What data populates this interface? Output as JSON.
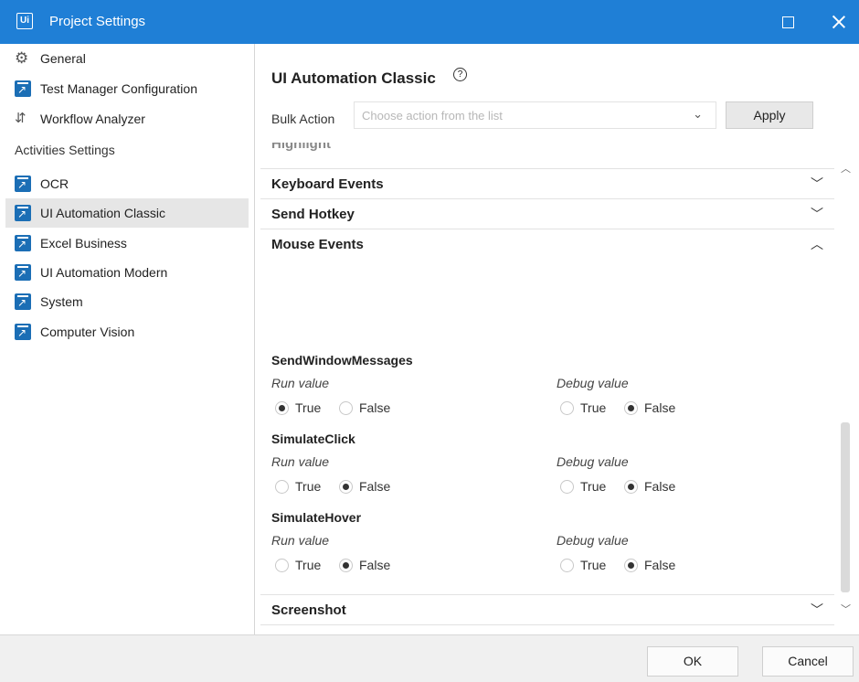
{
  "window": {
    "logo_text": "Ui",
    "title": "Project Settings"
  },
  "sidebar": {
    "items_top": [
      {
        "label": "General",
        "icon": "gear-icon"
      },
      {
        "label": "Test Manager Configuration",
        "icon": "activity-package-icon"
      },
      {
        "label": "Workflow Analyzer",
        "icon": "workflow-analyzer-icon"
      }
    ],
    "section_header": "Activities Settings",
    "items": [
      {
        "label": "OCR",
        "icon": "activity-package-icon"
      },
      {
        "label": "UI Automation Classic",
        "icon": "activity-package-icon",
        "selected": true
      },
      {
        "label": "Excel Business",
        "icon": "activity-package-icon"
      },
      {
        "label": "UI Automation Modern",
        "icon": "activity-package-icon"
      },
      {
        "label": "System",
        "icon": "activity-package-icon"
      },
      {
        "label": "Computer Vision",
        "icon": "activity-package-icon"
      }
    ]
  },
  "main": {
    "title": "UI Automation Classic",
    "help_glyph": "?",
    "bulk_action_label": "Bulk Action",
    "bulk_action_placeholder": "Choose action from the list",
    "apply_label": "Apply",
    "sections": [
      {
        "label": "Highlight",
        "state": "collapsed"
      },
      {
        "label": "Keyboard Events",
        "state": "collapsed"
      },
      {
        "label": "Send Hotkey",
        "state": "collapsed"
      },
      {
        "label": "Mouse Events",
        "state": "expanded"
      },
      {
        "label": "Screenshot",
        "state": "collapsed"
      }
    ],
    "properties": [
      {
        "name": "SendWindowMessages",
        "run_label": "Run value",
        "debug_label": "Debug value",
        "run_value": "True",
        "debug_value": "False"
      },
      {
        "name": "SimulateClick",
        "run_label": "Run value",
        "debug_label": "Debug value",
        "run_value": "False",
        "debug_value": "False"
      },
      {
        "name": "SimulateHover",
        "run_label": "Run value",
        "debug_label": "Debug value",
        "run_value": "False",
        "debug_value": "False"
      }
    ],
    "option_true": "True",
    "option_false": "False"
  },
  "footer": {
    "ok_label": "OK",
    "cancel_label": "Cancel"
  },
  "colors": {
    "titlebar": "#1f7fd6",
    "selected_item": "#e6e6e6",
    "package_icon": "#1b6eb5"
  }
}
